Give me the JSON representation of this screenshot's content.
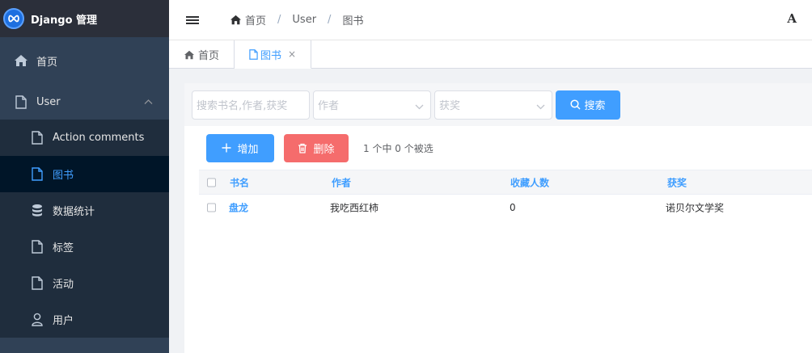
{
  "brand": {
    "title": "Django 管理",
    "logo_icon": "infinity-logo-icon"
  },
  "sidebar": {
    "items": [
      {
        "label": "首页",
        "icon": "home-icon",
        "level": "top"
      },
      {
        "label": "User",
        "icon": "document-icon",
        "level": "top",
        "expanded": true
      },
      {
        "label": "Action comments",
        "icon": "document-icon",
        "level": "sub"
      },
      {
        "label": "图书",
        "icon": "document-icon",
        "level": "sub",
        "active": true
      },
      {
        "label": "数据统计",
        "icon": "database-icon",
        "level": "sub"
      },
      {
        "label": "标签",
        "icon": "document-icon",
        "level": "sub"
      },
      {
        "label": "活动",
        "icon": "document-icon",
        "level": "sub"
      },
      {
        "label": "用户",
        "icon": "user-icon",
        "level": "sub"
      }
    ]
  },
  "header": {
    "breadcrumbs": [
      "首页",
      "User",
      "图书"
    ],
    "separator": "/",
    "font_button": "A"
  },
  "tabs": [
    {
      "label": "首页",
      "icon": "home-icon",
      "active": false
    },
    {
      "label": "图书",
      "icon": "document-icon",
      "active": true,
      "closable": true,
      "close_glyph": "×"
    }
  ],
  "search": {
    "keyword_placeholder": "搜索书名,作者,获奖",
    "author_placeholder": "作者",
    "award_placeholder": "获奖",
    "button_label": "搜索"
  },
  "actions": {
    "add_label": "增加",
    "delete_label": "删除",
    "selection_info": "1 个中 0 个被选"
  },
  "table": {
    "columns": [
      "书名",
      "作者",
      "收藏人数",
      "获奖"
    ],
    "rows": [
      [
        "盘龙",
        "我吃西红柿",
        "0",
        "诺贝尔文学奖"
      ]
    ]
  },
  "colors": {
    "sidebar_bg": "#304156",
    "primary": "#409eff",
    "danger": "#f56c6c"
  }
}
